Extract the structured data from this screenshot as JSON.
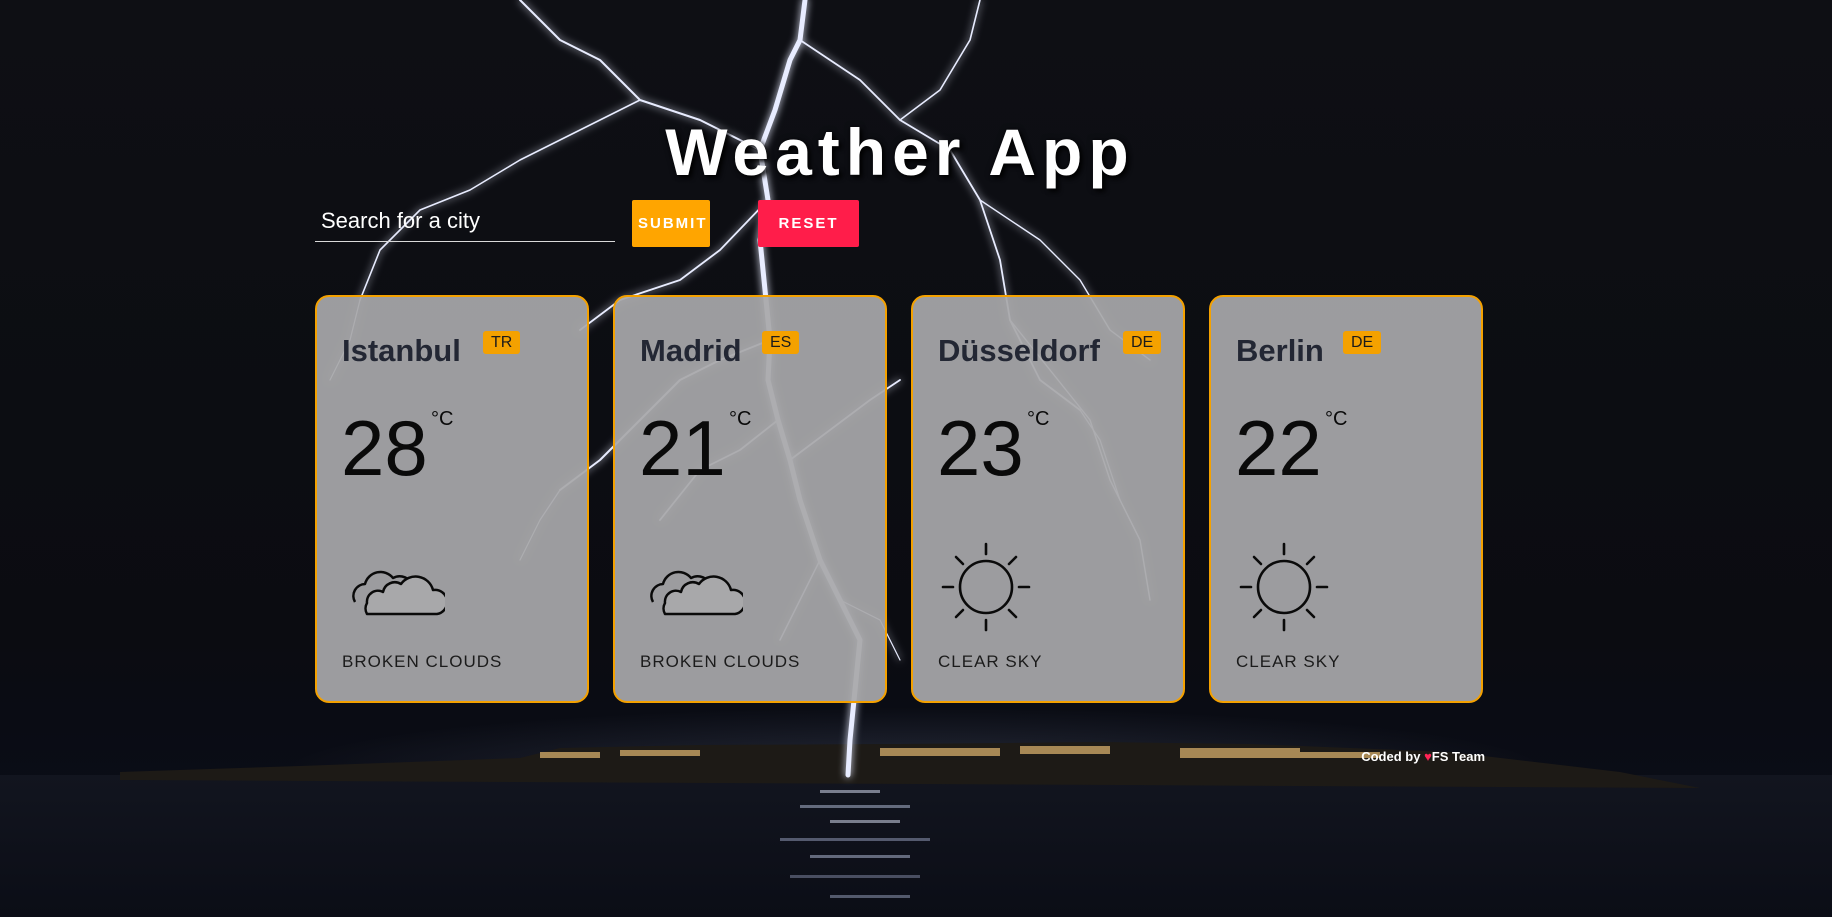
{
  "app": {
    "title": "Weather App"
  },
  "search": {
    "placeholder": "Search for a city",
    "value": "",
    "submit_label": "SUBMIT",
    "reset_label": "RESET",
    "submit_color": "#ffa500",
    "reset_color": "#ff1d4a"
  },
  "cards": [
    {
      "city": "Istanbul",
      "country": "TR",
      "temp": "28",
      "unit": "°C",
      "icon": "broken-clouds-icon",
      "description": "BROKEN CLOUDS"
    },
    {
      "city": "Madrid",
      "country": "ES",
      "temp": "21",
      "unit": "°C",
      "icon": "broken-clouds-icon",
      "description": "BROKEN CLOUDS"
    },
    {
      "city": "Düsseldorf",
      "country": "DE",
      "temp": "23",
      "unit": "°C",
      "icon": "clear-sky-sun-icon",
      "description": "CLEAR SKY"
    },
    {
      "city": "Berlin",
      "country": "DE",
      "temp": "22",
      "unit": "°C",
      "icon": "clear-sky-sun-icon",
      "description": "CLEAR SKY"
    }
  ],
  "footer": {
    "prefix": "Coded by",
    "heart": "♥",
    "author": "FS Team"
  },
  "colors": {
    "accent": "#f4a100",
    "card_background": "#a8a8aa",
    "page_background": "#0e0f14",
    "heart": "#ff2455"
  }
}
